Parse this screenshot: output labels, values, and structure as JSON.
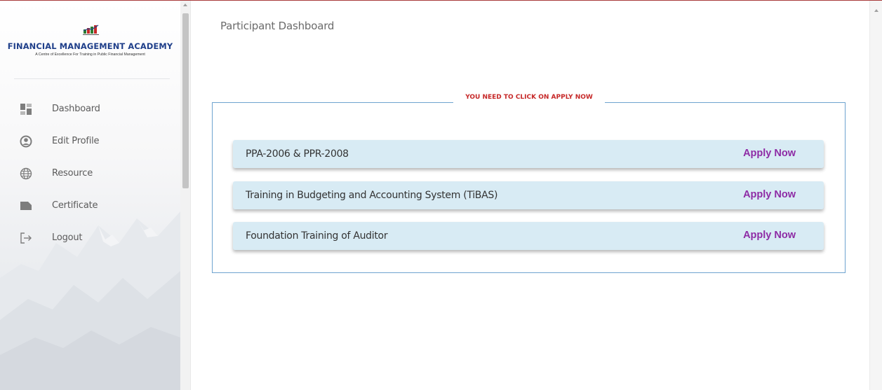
{
  "brand": {
    "title": "FINANCIAL MANAGEMENT ACADEMY",
    "subtitle": "A Centre of Excellence For Training in Public Financial Management",
    "primary_color": "#1f3f8a",
    "icon": "fima-logo-icon"
  },
  "sidebar": {
    "items": [
      {
        "label": "Dashboard",
        "icon": "dashboard-icon"
      },
      {
        "label": "Edit Profile",
        "icon": "user-circle-icon"
      },
      {
        "label": "Resource",
        "icon": "globe-icon"
      },
      {
        "label": "Certificate",
        "icon": "folder-icon"
      },
      {
        "label": "Logout",
        "icon": "logout-icon"
      }
    ]
  },
  "main": {
    "page_title": "Participant Dashboard",
    "panel_notice": "YOU NEED TO CLICK ON APPLY NOW",
    "notice_color": "#c62828",
    "courses": [
      {
        "name": "PPA-2006 & PPR-2008",
        "action": "Apply Now"
      },
      {
        "name": "Training in Budgeting and Accounting System (TiBAS)",
        "action": "Apply Now"
      },
      {
        "name": "Foundation Training of Auditor",
        "action": "Apply Now"
      }
    ],
    "action_color": "#8e2ba5",
    "card_color": "#d8ebf4"
  }
}
